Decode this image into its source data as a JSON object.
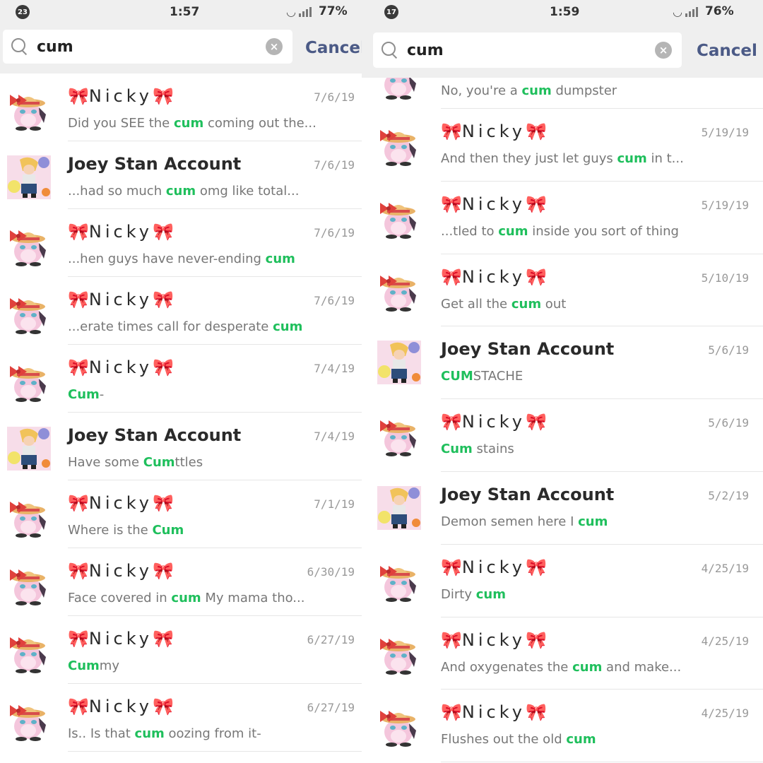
{
  "left": {
    "status": {
      "notif_count": "23",
      "time": "1:57",
      "battery": "77%"
    },
    "search": {
      "query": "cum",
      "cancel_label": "Cancel"
    },
    "results": [
      {
        "name": "Nicky",
        "date": "7/6/19",
        "before": "Did you SEE the ",
        "hl": "cum",
        "after": " coming out the...",
        "avatar": "nicky"
      },
      {
        "name": "Joey Stan Account",
        "date": "7/6/19",
        "before": "...had so much ",
        "hl": "cum",
        "after": " omg like total...",
        "avatar": "joey"
      },
      {
        "name": "Nicky",
        "date": "7/6/19",
        "before": "...hen guys have never-ending ",
        "hl": "cum",
        "after": "",
        "avatar": "nicky"
      },
      {
        "name": "Nicky",
        "date": "7/6/19",
        "before": "...erate times call for desperate ",
        "hl": "cum",
        "after": "",
        "avatar": "nicky"
      },
      {
        "name": "Nicky",
        "date": "7/4/19",
        "before": "",
        "hl": "Cum",
        "after": "-",
        "avatar": "nicky"
      },
      {
        "name": "Joey Stan Account",
        "date": "7/4/19",
        "before": "Have some ",
        "hl": "Cum",
        "after": "ttles",
        "avatar": "joey"
      },
      {
        "name": "Nicky",
        "date": "7/1/19",
        "before": "Where is the ",
        "hl": "Cum",
        "after": "",
        "avatar": "nicky"
      },
      {
        "name": "Nicky",
        "date": "6/30/19",
        "before": "Face covered in ",
        "hl": "cum",
        "after": " My mama tho...",
        "avatar": "nicky"
      },
      {
        "name": "Nicky",
        "date": "6/27/19",
        "before": "",
        "hl": "Cum",
        "after": "my",
        "avatar": "nicky"
      },
      {
        "name": "Nicky",
        "date": "6/27/19",
        "before": "Is.. Is that ",
        "hl": "cum",
        "after": " oozing from it-",
        "avatar": "nicky"
      }
    ]
  },
  "right": {
    "status": {
      "notif_count": "17",
      "time": "1:59",
      "battery": "76%"
    },
    "search": {
      "query": "cum",
      "cancel_label": "Cancel"
    },
    "partial_result": {
      "before": "No, you're a ",
      "hl": "cum",
      "after": " dumpster",
      "avatar": "nicky"
    },
    "results": [
      {
        "name": "Nicky",
        "date": "5/19/19",
        "before": "And then they just let guys ",
        "hl": "cum",
        "after": " in t...",
        "avatar": "nicky"
      },
      {
        "name": "Nicky",
        "date": "5/19/19",
        "before": "...tled to ",
        "hl": "cum",
        "after": " inside you sort of thing",
        "avatar": "nicky"
      },
      {
        "name": "Nicky",
        "date": "5/10/19",
        "before": "Get all the ",
        "hl": "cum",
        "after": " out",
        "avatar": "nicky"
      },
      {
        "name": "Joey Stan Account",
        "date": "5/6/19",
        "before": "",
        "hl": "CUM",
        "after": "STACHE",
        "avatar": "joey"
      },
      {
        "name": "Nicky",
        "date": "5/6/19",
        "before": "",
        "hl": "Cum",
        "after": " stains",
        "avatar": "nicky"
      },
      {
        "name": "Joey Stan Account",
        "date": "5/2/19",
        "before": "Demon semen here I ",
        "hl": "cum",
        "after": "",
        "avatar": "joey"
      },
      {
        "name": "Nicky",
        "date": "4/25/19",
        "before": "Dirty ",
        "hl": "cum",
        "after": "",
        "avatar": "nicky"
      },
      {
        "name": "Nicky",
        "date": "4/25/19",
        "before": "And oxygenates the ",
        "hl": "cum",
        "after": " and make...",
        "avatar": "nicky"
      },
      {
        "name": "Nicky",
        "date": "4/25/19",
        "before": "Flushes out the old ",
        "hl": "cum",
        "after": "",
        "avatar": "nicky"
      }
    ]
  },
  "theme": {
    "highlight": "#1fbf5c",
    "cancel": "#4b5a86",
    "bow": "#e77ba8"
  }
}
